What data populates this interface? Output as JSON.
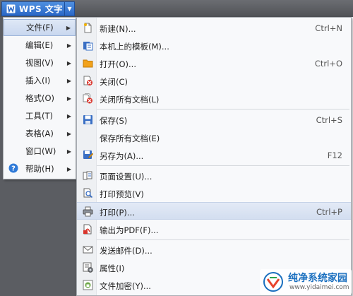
{
  "app": {
    "title": "WPS 文字"
  },
  "main_menu": {
    "items": [
      {
        "label": "文件(F)",
        "active": true
      },
      {
        "label": "编辑(E)"
      },
      {
        "label": "视图(V)"
      },
      {
        "label": "插入(I)"
      },
      {
        "label": "格式(O)"
      },
      {
        "label": "工具(T)"
      },
      {
        "label": "表格(A)"
      },
      {
        "label": "窗口(W)"
      },
      {
        "label": "帮助(H)",
        "icon": "help-icon"
      }
    ]
  },
  "file_menu": {
    "items": [
      {
        "label": "新建(N)...",
        "shortcut": "Ctrl+N",
        "icon": "new-document-icon"
      },
      {
        "label": "本机上的模板(M)...",
        "shortcut": "",
        "icon": "template-icon"
      },
      {
        "label": "打开(O)...",
        "shortcut": "Ctrl+O",
        "icon": "open-folder-icon"
      },
      {
        "label": "关闭(C)",
        "shortcut": "",
        "icon": "close-document-icon"
      },
      {
        "label": "关闭所有文档(L)",
        "shortcut": "",
        "icon": "close-all-icon"
      },
      {
        "label": "保存(S)",
        "shortcut": "Ctrl+S",
        "icon": "save-icon"
      },
      {
        "label": "保存所有文档(E)",
        "shortcut": "",
        "icon": ""
      },
      {
        "label": "另存为(A)...",
        "shortcut": "F12",
        "icon": "save-as-icon"
      },
      {
        "label": "页面设置(U)...",
        "shortcut": "",
        "icon": "page-setup-icon"
      },
      {
        "label": "打印预览(V)",
        "shortcut": "",
        "icon": "print-preview-icon"
      },
      {
        "label": "打印(P)...",
        "shortcut": "Ctrl+P",
        "icon": "printer-icon",
        "hover": true
      },
      {
        "label": "输出为PDF(F)...",
        "shortcut": "",
        "icon": "pdf-icon"
      },
      {
        "label": "发送邮件(D)...",
        "shortcut": "",
        "icon": "mail-icon"
      },
      {
        "label": "属性(I)",
        "shortcut": "",
        "icon": "properties-icon"
      },
      {
        "label": "文件加密(Y)...",
        "shortcut": "",
        "icon": "encrypt-icon"
      }
    ]
  },
  "watermark": {
    "title": "纯净系统家园",
    "url": "www.yidaimei.com"
  },
  "colors": {
    "accent": "#2a67c6",
    "hover_bg": "#d3def0",
    "chrome": "#5b5d62"
  }
}
